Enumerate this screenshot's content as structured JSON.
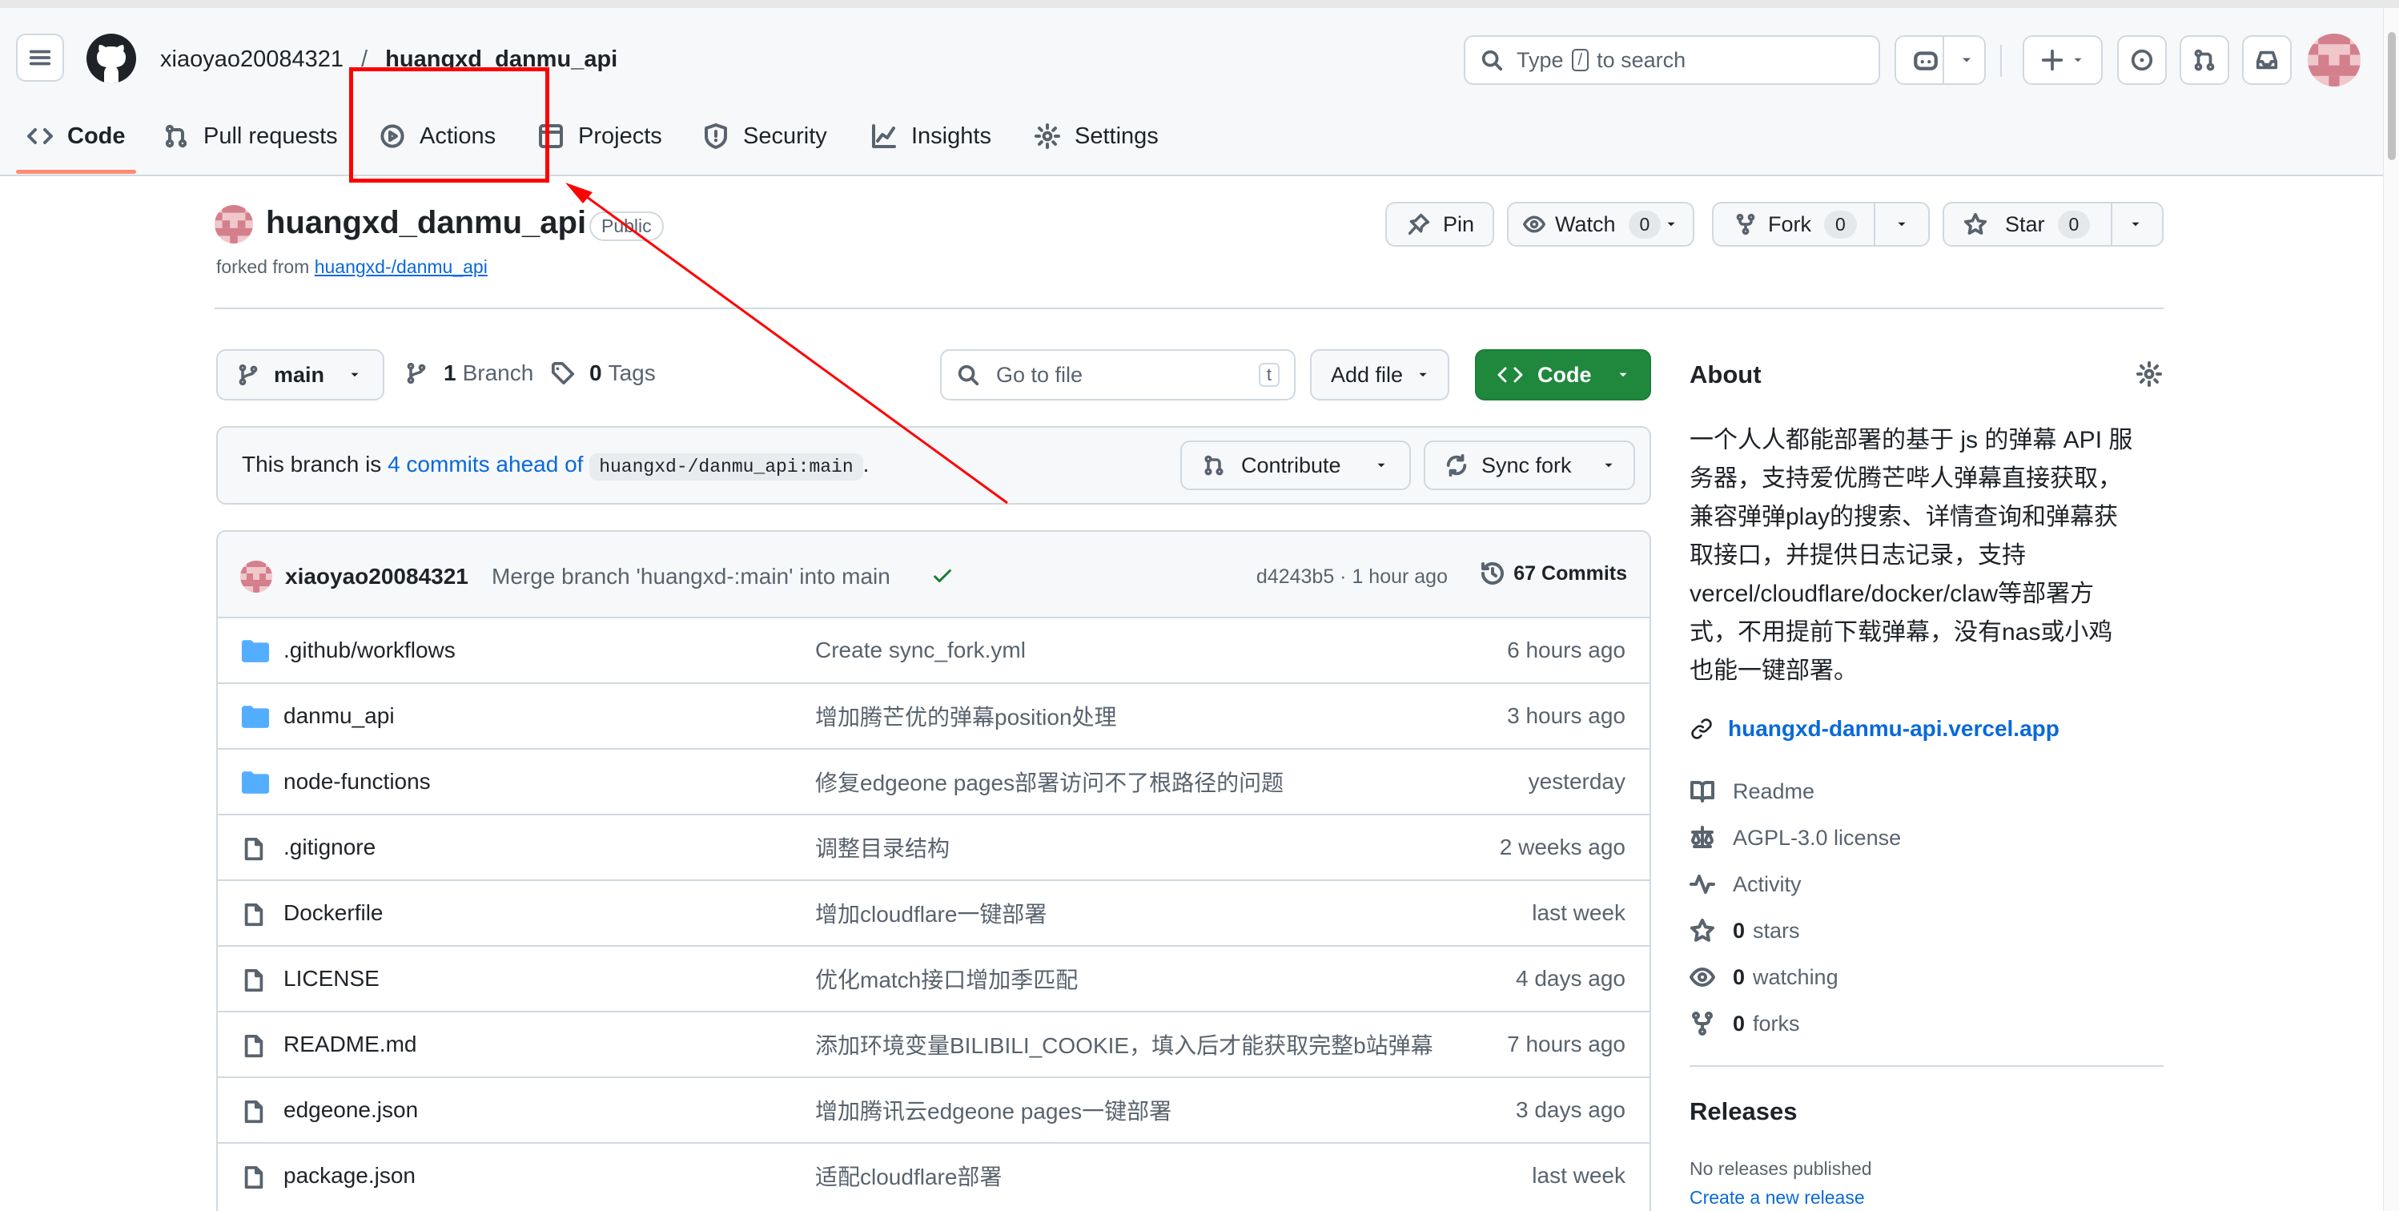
{
  "header": {
    "owner": "xiaoyao20084321",
    "slash": "/",
    "repo": "huangxd_danmu_api",
    "search_placeholder_pre": "Type",
    "search_key": "/",
    "search_placeholder_post": "to search"
  },
  "tabs": [
    {
      "label": "Code",
      "icon": "code-icon",
      "active": true
    },
    {
      "label": "Pull requests",
      "icon": "git-pull-request-icon"
    },
    {
      "label": "Actions",
      "icon": "play-icon"
    },
    {
      "label": "Projects",
      "icon": "table-icon"
    },
    {
      "label": "Security",
      "icon": "shield-icon"
    },
    {
      "label": "Insights",
      "icon": "graph-icon"
    },
    {
      "label": "Settings",
      "icon": "gear-icon"
    }
  ],
  "repo_header": {
    "name": "huangxd_danmu_api",
    "visibility": "Public",
    "forked_from_label": "forked from",
    "forked_from_link": "huangxd-/danmu_api",
    "pin": "Pin",
    "watch": "Watch",
    "watch_count": "0",
    "fork": "Fork",
    "fork_count": "0",
    "star": "Star",
    "star_count": "0"
  },
  "toolbar": {
    "branch": "main",
    "branch_count": "1",
    "branch_label": "Branch",
    "tag_count": "0",
    "tag_label": "Tags",
    "goto_placeholder": "Go to file",
    "goto_key": "t",
    "add_file": "Add file",
    "code": "Code"
  },
  "branch_status": {
    "pre": "This branch is",
    "link": "4 commits ahead of",
    "ref": "huangxd-/danmu_api:main",
    "post": ".",
    "contribute": "Contribute",
    "sync": "Sync fork"
  },
  "latest_commit": {
    "author": "xiaoyao20084321",
    "message": "Merge branch 'huangxd-:main' into main",
    "hash_time": "d4243b5 · 1 hour ago",
    "commits": "67 Commits"
  },
  "files": [
    {
      "name": ".github/workflows",
      "type": "dir",
      "message": "Create sync_fork.yml",
      "time": "6 hours ago"
    },
    {
      "name": "danmu_api",
      "type": "dir",
      "message": "增加腾芒优的弹幕position处理",
      "time": "3 hours ago"
    },
    {
      "name": "node-functions",
      "type": "dir",
      "message": "修复edgeone pages部署访问不了根路径的问题",
      "time": "yesterday"
    },
    {
      "name": ".gitignore",
      "type": "file",
      "message": "调整目录结构",
      "time": "2 weeks ago"
    },
    {
      "name": "Dockerfile",
      "type": "file",
      "message": "增加cloudflare一键部署",
      "time": "last week"
    },
    {
      "name": "LICENSE",
      "type": "file",
      "message": "优化match接口增加季匹配",
      "time": "4 days ago"
    },
    {
      "name": "README.md",
      "type": "file",
      "message": "添加环境变量BILIBILI_COOKIE，填入后才能获取完整b站弹幕",
      "time": "7 hours ago"
    },
    {
      "name": "edgeone.json",
      "type": "file",
      "message": "增加腾讯云edgeone pages一键部署",
      "time": "3 days ago"
    },
    {
      "name": "package.json",
      "type": "file",
      "message": "适配cloudflare部署",
      "time": "last week"
    }
  ],
  "about": {
    "title": "About",
    "desc_lines": [
      "一个人人都能部署的基于 js 的弹幕 API 服",
      "务器，支持爱优腾芒哔人弹幕直接获取，",
      "兼容弹弹play的搜索、详情查询和弹幕获",
      "取接口，并提供日志记录，支持",
      "vercel/cloudflare/docker/claw等部署方",
      "式，不用提前下载弹幕，没有nas或小鸡",
      "也能一键部署。"
    ],
    "link": "huangxd-danmu-api.vercel.app",
    "readme": "Readme",
    "license": "AGPL-3.0 license",
    "activity": "Activity",
    "stars_count": "0",
    "stars_label": "stars",
    "watching_count": "0",
    "watching_label": "watching",
    "forks_count": "0",
    "forks_label": "forks"
  },
  "releases": {
    "title": "Releases",
    "none": "No releases published",
    "create": "Create a new release"
  },
  "colors": {
    "accent": "#0969da",
    "green": "#1f883d",
    "annotation": "#ff0000",
    "folder": "#54aeff"
  }
}
